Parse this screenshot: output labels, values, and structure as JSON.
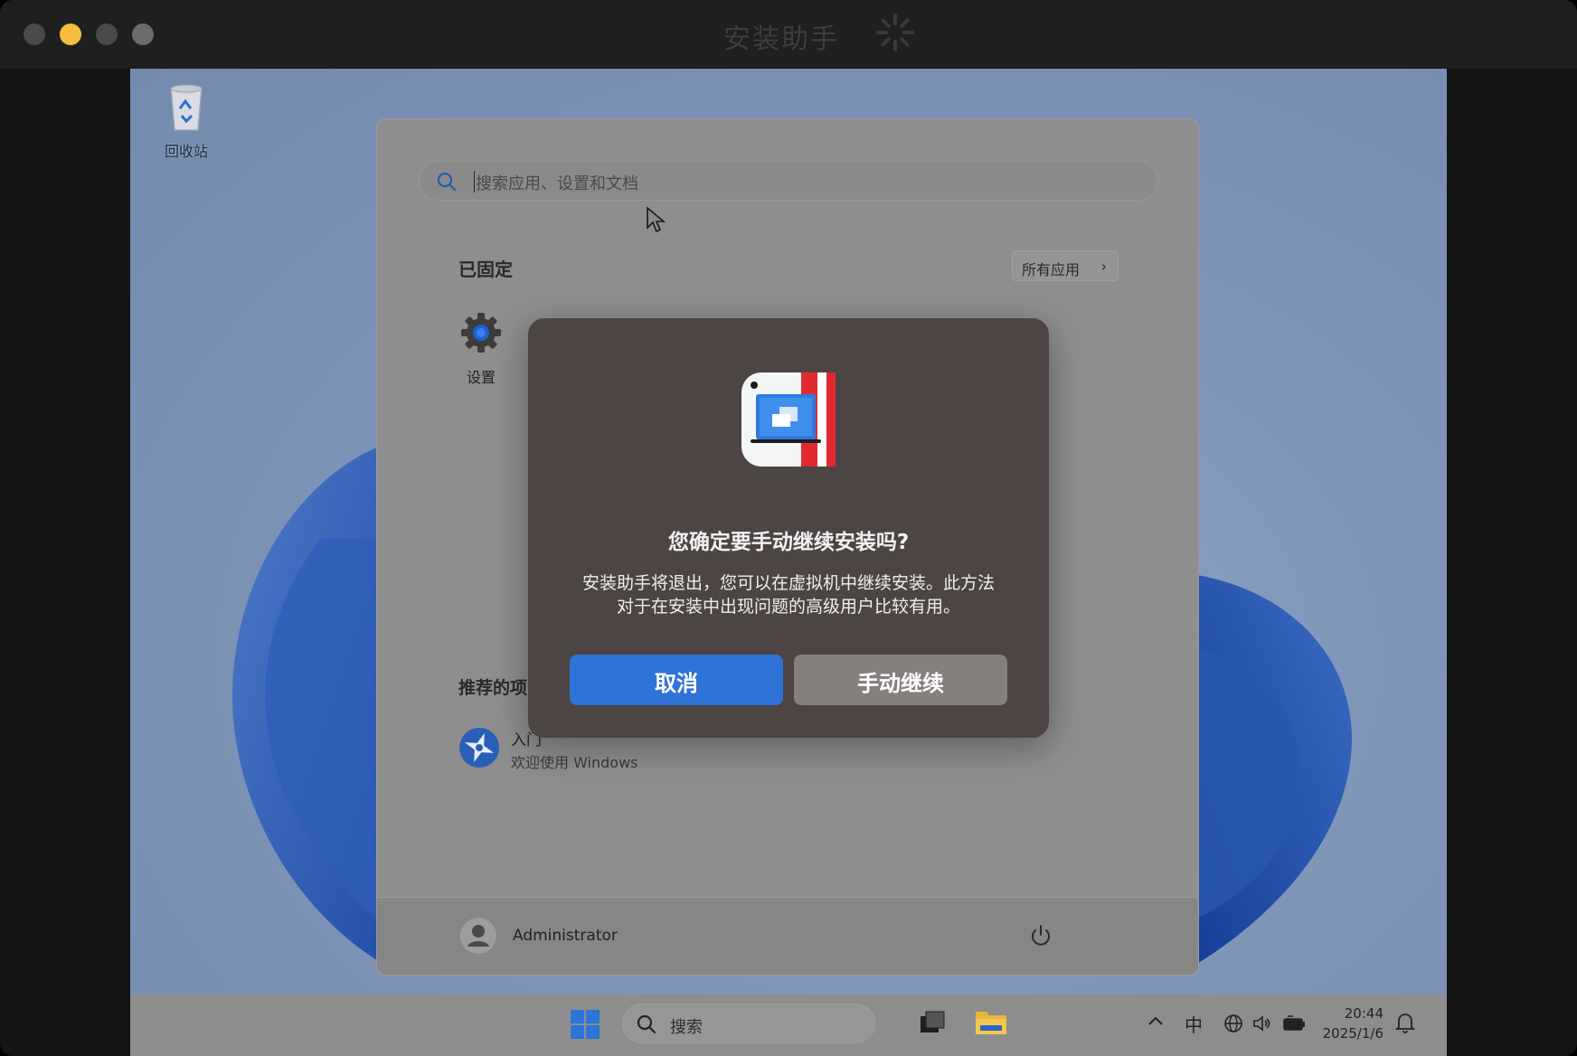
{
  "window": {
    "title": "安装助手",
    "traffic_lights": [
      "close",
      "minimize",
      "zoom",
      "fullscreen"
    ]
  },
  "desktop": {
    "recycle_bin_label": "回收站"
  },
  "start_menu": {
    "search_placeholder": "搜索应用、设置和文档",
    "pinned_heading": "已固定",
    "all_apps_label": "所有应用",
    "pinned_apps": [
      {
        "label": "设置",
        "icon": "gear-icon"
      }
    ],
    "recommended_heading": "推荐的项",
    "recommended_items": [
      {
        "title": "入门",
        "subtitle": "欢迎使用 Windows",
        "icon": "get-started-icon"
      }
    ],
    "user_name": "Administrator"
  },
  "taskbar": {
    "search_placeholder": "搜索",
    "ime_indicator": "中",
    "time": "20:44",
    "date": "2025/1/6"
  },
  "dialog": {
    "title": "您确定要手动继续安装吗?",
    "message_line1": "安装助手将退出，您可以在虚拟机中继续安装。此方法",
    "message_line2": "对于在安装中出现问题的高级用户比较有用。",
    "cancel_label": "取消",
    "continue_label": "手动继续"
  },
  "colors": {
    "primary_button": "#2f73d6",
    "secondary_button": "#857f7e",
    "dialog_bg": "#4d4544",
    "minimize_light": "#f5be3c"
  }
}
